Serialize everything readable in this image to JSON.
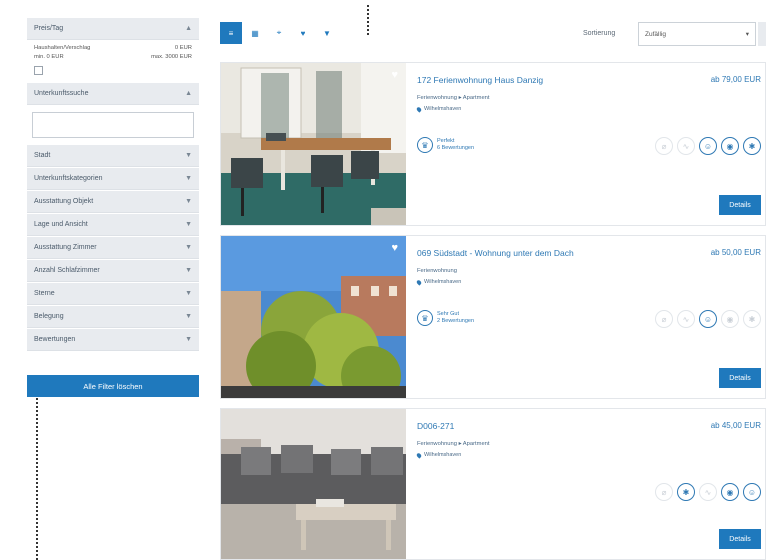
{
  "sidebar": {
    "price_header": "Preis/Tag",
    "price_left_label": "Haushalten/Verschlag",
    "price_left_value": "0 EUR",
    "price_min": "min. 0 EUR",
    "price_max": "max. 3000 EUR",
    "search_header": "Unterkunftssuche",
    "search_placeholder": "",
    "filters": [
      {
        "label": "Stadt"
      },
      {
        "label": "Unterkunftskategorien"
      },
      {
        "label": "Ausstattung Objekt"
      },
      {
        "label": "Lage und Ansicht"
      },
      {
        "label": "Ausstattung Zimmer"
      },
      {
        "label": "Anzahl Schlafzimmer"
      },
      {
        "label": "Sterne"
      },
      {
        "label": "Belegung"
      },
      {
        "label": "Bewertungen"
      }
    ],
    "filter_button": "Alle Filter löschen"
  },
  "toolbar": {
    "views": [
      "≡",
      "▦",
      "⌖",
      "♥",
      "▼"
    ],
    "sort_label": "Sortierung",
    "sort_value": "Zufällig",
    "sort_arrow": "▾"
  },
  "listings": [
    {
      "title": "172 Ferienwohnung Haus Danzig",
      "price": "ab 79,00 EUR",
      "type": "Ferienwohnung  ▸  Apartment",
      "location": "Wilhelmshaven",
      "rating_label": "Perfekt",
      "rating_count": "6 Bewertungen",
      "details": "Details"
    },
    {
      "title": "069 Südstadt - Wohnung unter dem Dach",
      "price": "ab 50,00 EUR",
      "type": "Ferienwohnung",
      "location": "Wilhelmshaven",
      "rating_label": "Sehr Gut",
      "rating_count": "2 Bewertungen",
      "details": "Details"
    },
    {
      "title": "D006-271",
      "price": "ab 45,00 EUR",
      "type": "Ferienwohnung  ▸  Apartment",
      "location": "Wilhelmshaven",
      "details": "Details"
    }
  ],
  "colors": {
    "accent": "#1f79bd",
    "link": "#2f79b4"
  }
}
